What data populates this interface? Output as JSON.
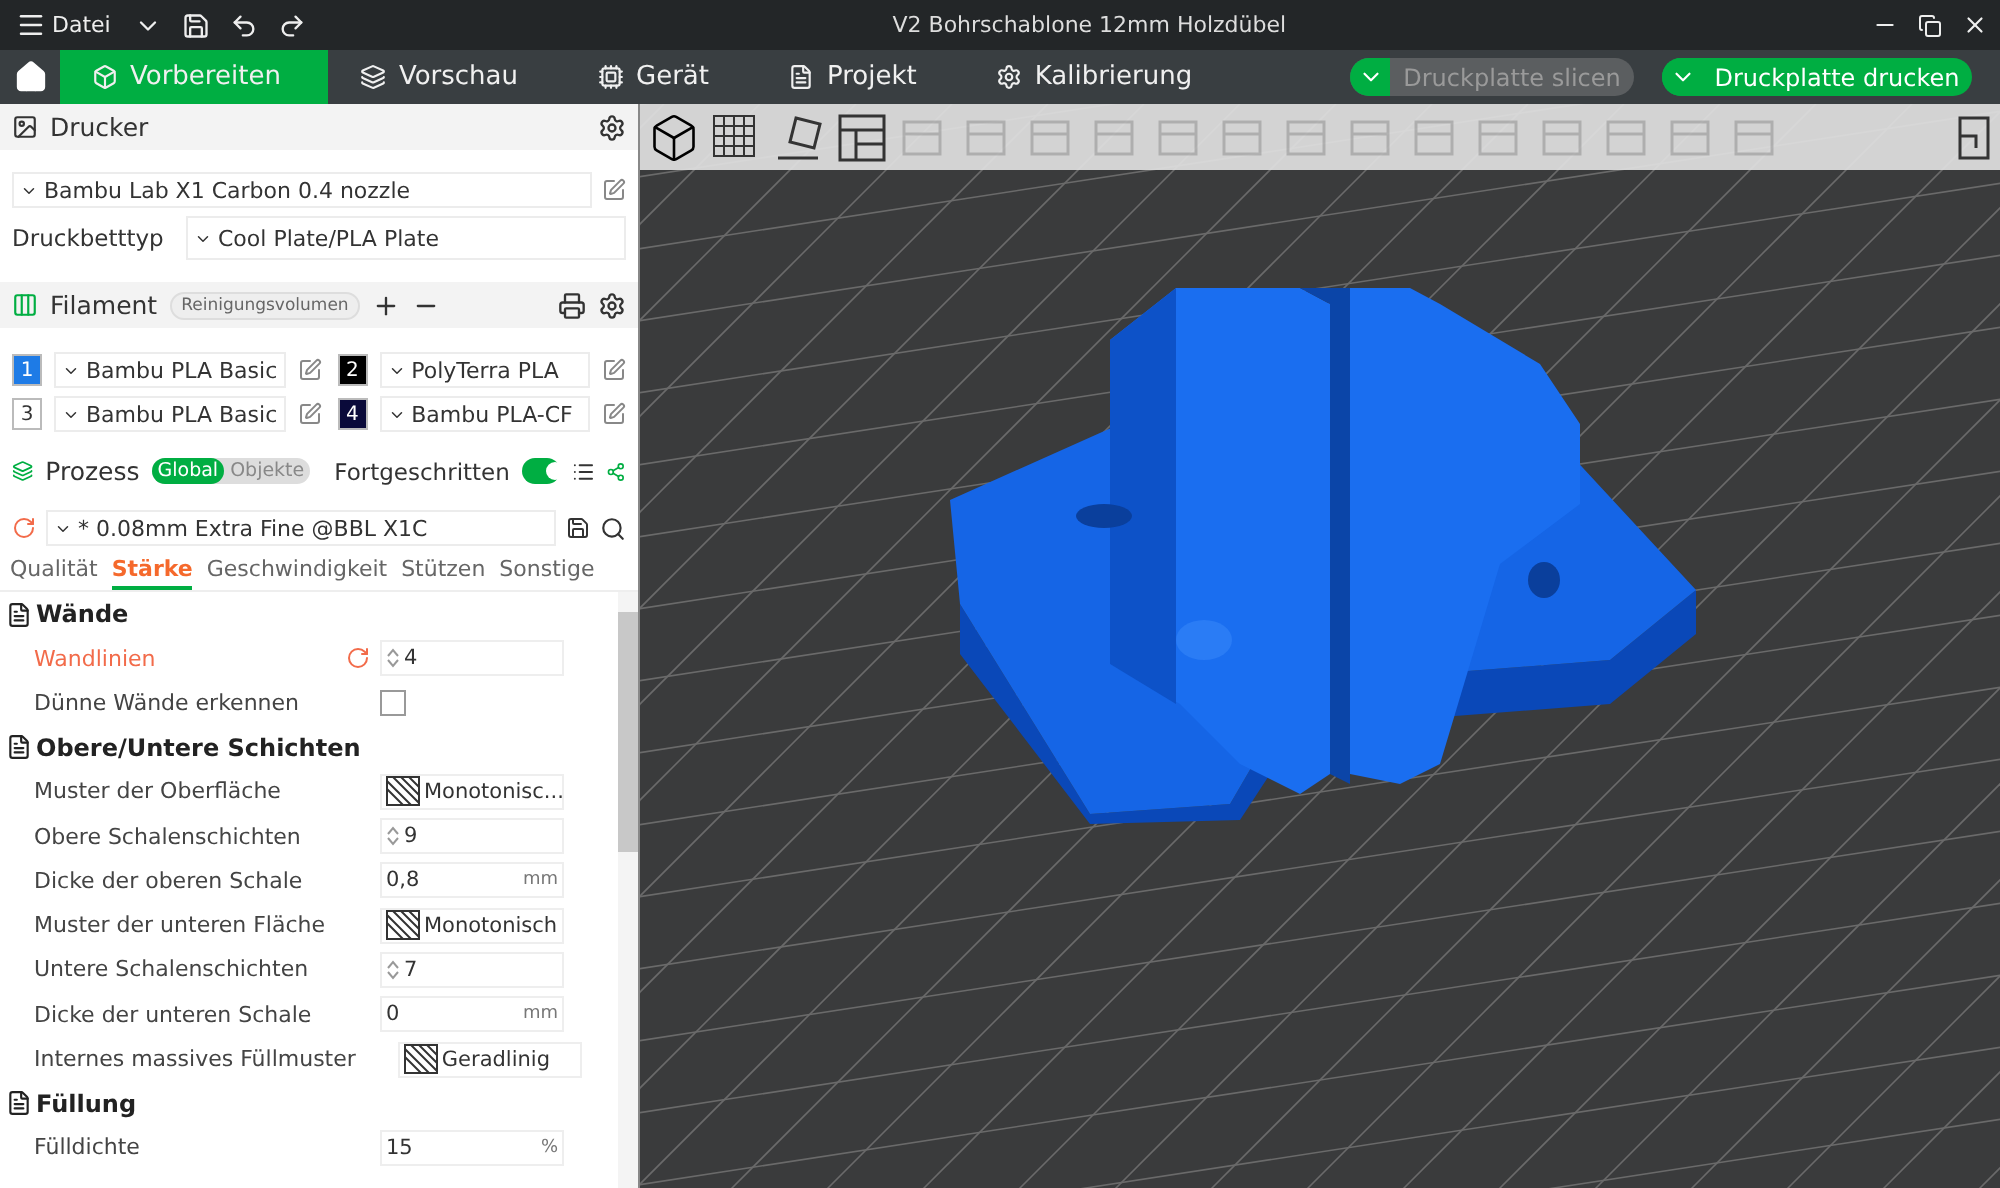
{
  "title_bar": {
    "menu_label": "Datei",
    "title": "V2 Bohrschablone 12mm Holzdübel"
  },
  "nav_tabs": [
    {
      "label": "Vorbereiten",
      "selected": true
    },
    {
      "label": "Vorschau",
      "selected": false
    },
    {
      "label": "Gerät",
      "selected": false
    },
    {
      "label": "Projekt",
      "selected": false
    },
    {
      "label": "Kalibrierung",
      "selected": false
    }
  ],
  "plate_actions": [
    {
      "label": "Druckplatte slicen",
      "disabled": true
    },
    {
      "label": "Druckplatte drucken",
      "disabled": false
    }
  ],
  "printer": {
    "heading": "Drucker",
    "printer": "Bambu Lab X1 Carbon 0.4 nozzle",
    "bed_label": "Druckbetttyp",
    "bed_value": "Cool Plate/PLA Plate"
  },
  "filament": {
    "heading": "Filament",
    "purge_button": "Reinigungsvolumen",
    "slots": [
      {
        "number": "1",
        "color": "#1e7be6",
        "name": "Bambu PLA Basic"
      },
      {
        "number": "2",
        "color": "#000000",
        "name": "PolyTerra PLA"
      },
      {
        "number": "3",
        "color": "#ffffff",
        "name": "Bambu PLA Basic"
      },
      {
        "number": "4",
        "color": "#0a0a3a",
        "name": "Bambu PLA-CF"
      }
    ]
  },
  "process": {
    "heading": "Prozess",
    "scope": [
      {
        "label": "Global",
        "selected": true
      },
      {
        "label": "Objekte",
        "selected": false
      }
    ],
    "advanced_label": "Fortgeschritten",
    "advanced_on": true,
    "preset": "* 0.08mm Extra Fine @BBL X1C",
    "tabs": [
      {
        "label": "Qualität",
        "selected": false
      },
      {
        "label": "Stärke",
        "selected": true
      },
      {
        "label": "Geschwindigkeit",
        "selected": false
      },
      {
        "label": "Stützen",
        "selected": false
      },
      {
        "label": "Sonstige",
        "selected": false
      }
    ],
    "groups": [
      {
        "title": "Wände",
        "settings": [
          {
            "label": "Wandlinien",
            "kind": "spin",
            "value": "4",
            "modified": true
          },
          {
            "label": "Dünne Wände erkennen",
            "kind": "checkbox",
            "checked": false,
            "modified": false
          }
        ]
      },
      {
        "title": "Obere/Untere Schichten",
        "settings": [
          {
            "label": "Muster der Oberfläche",
            "kind": "pattern",
            "value": "Monotonisc...",
            "modified": false
          },
          {
            "label": "Obere Schalenschichten",
            "kind": "spin",
            "value": "9",
            "modified": false
          },
          {
            "label": "Dicke der oberen Schale",
            "kind": "unit",
            "value": "0,8",
            "unit": "mm",
            "modified": false
          },
          {
            "label": "Muster der unteren Fläche",
            "kind": "pattern",
            "value": "Monotonisch",
            "modified": false
          },
          {
            "label": "Untere Schalenschichten",
            "kind": "spin",
            "value": "7",
            "modified": false
          },
          {
            "label": "Dicke der unteren Schale",
            "kind": "unit",
            "value": "0",
            "unit": "mm",
            "modified": false
          },
          {
            "label": "Internes massives Füllmuster",
            "kind": "pattern",
            "value": "Geradlinig",
            "modified": false
          }
        ]
      },
      {
        "title": "Füllung",
        "settings": [
          {
            "label": "Fülldichte",
            "kind": "unit",
            "value": "15",
            "unit": "%",
            "modified": false
          }
        ]
      }
    ]
  }
}
